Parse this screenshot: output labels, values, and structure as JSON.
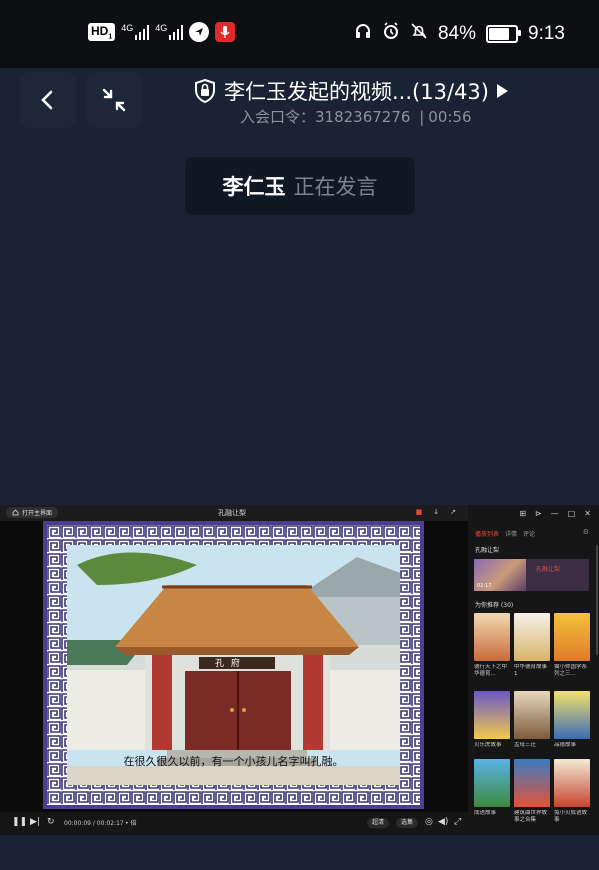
{
  "status_bar": {
    "hd": "HD",
    "hd_sub": "1",
    "net1": "4G",
    "net2": "4G",
    "battery_level": 84,
    "battery": "84%",
    "time": "9:13"
  },
  "header": {
    "title": "李仁玉发起的视频...(13/43)",
    "meeting_code_label": "入会口令：3182367276",
    "separator": "|",
    "duration": "00:56"
  },
  "speaker": {
    "name": "李仁玉",
    "status": "正在发言"
  },
  "shared_screen": {
    "open_main": "打开主界面",
    "video_title": "孔融让梨",
    "subtitle": "在很久很久以前，有一个小孩儿名字叫孔融。",
    "plaque": "孔 府",
    "controls": {
      "time": "00:00:09 / 00:02:17",
      "speed": "倍",
      "btn_hd": "超清",
      "btn_select": "选集"
    },
    "sidebar": {
      "tabs": [
        "播放列表",
        "详情",
        "评论"
      ],
      "current_label": "孔融让梨",
      "current_duration": "02:17",
      "current_title": "孔融让梨",
      "recommend_label": "为你推荐 (30)",
      "cards": [
        {
          "caption": "德行天下之中华德育..."
        },
        {
          "caption": "中华德育故事1"
        },
        {
          "caption": "猫小帅国学系列之三..."
        },
        {
          "caption": "贝乐虎故事"
        },
        {
          "caption": "孟母三迁"
        },
        {
          "caption": "品德故事"
        },
        {
          "caption": "成语故事"
        },
        {
          "caption": "建筑曲世界故事之合集"
        },
        {
          "caption": "兔小贝成语故事"
        }
      ]
    }
  },
  "colors": {
    "background": "#1a2333",
    "accent_red": "#e74a3b",
    "mic_red": "#e02a2a"
  }
}
